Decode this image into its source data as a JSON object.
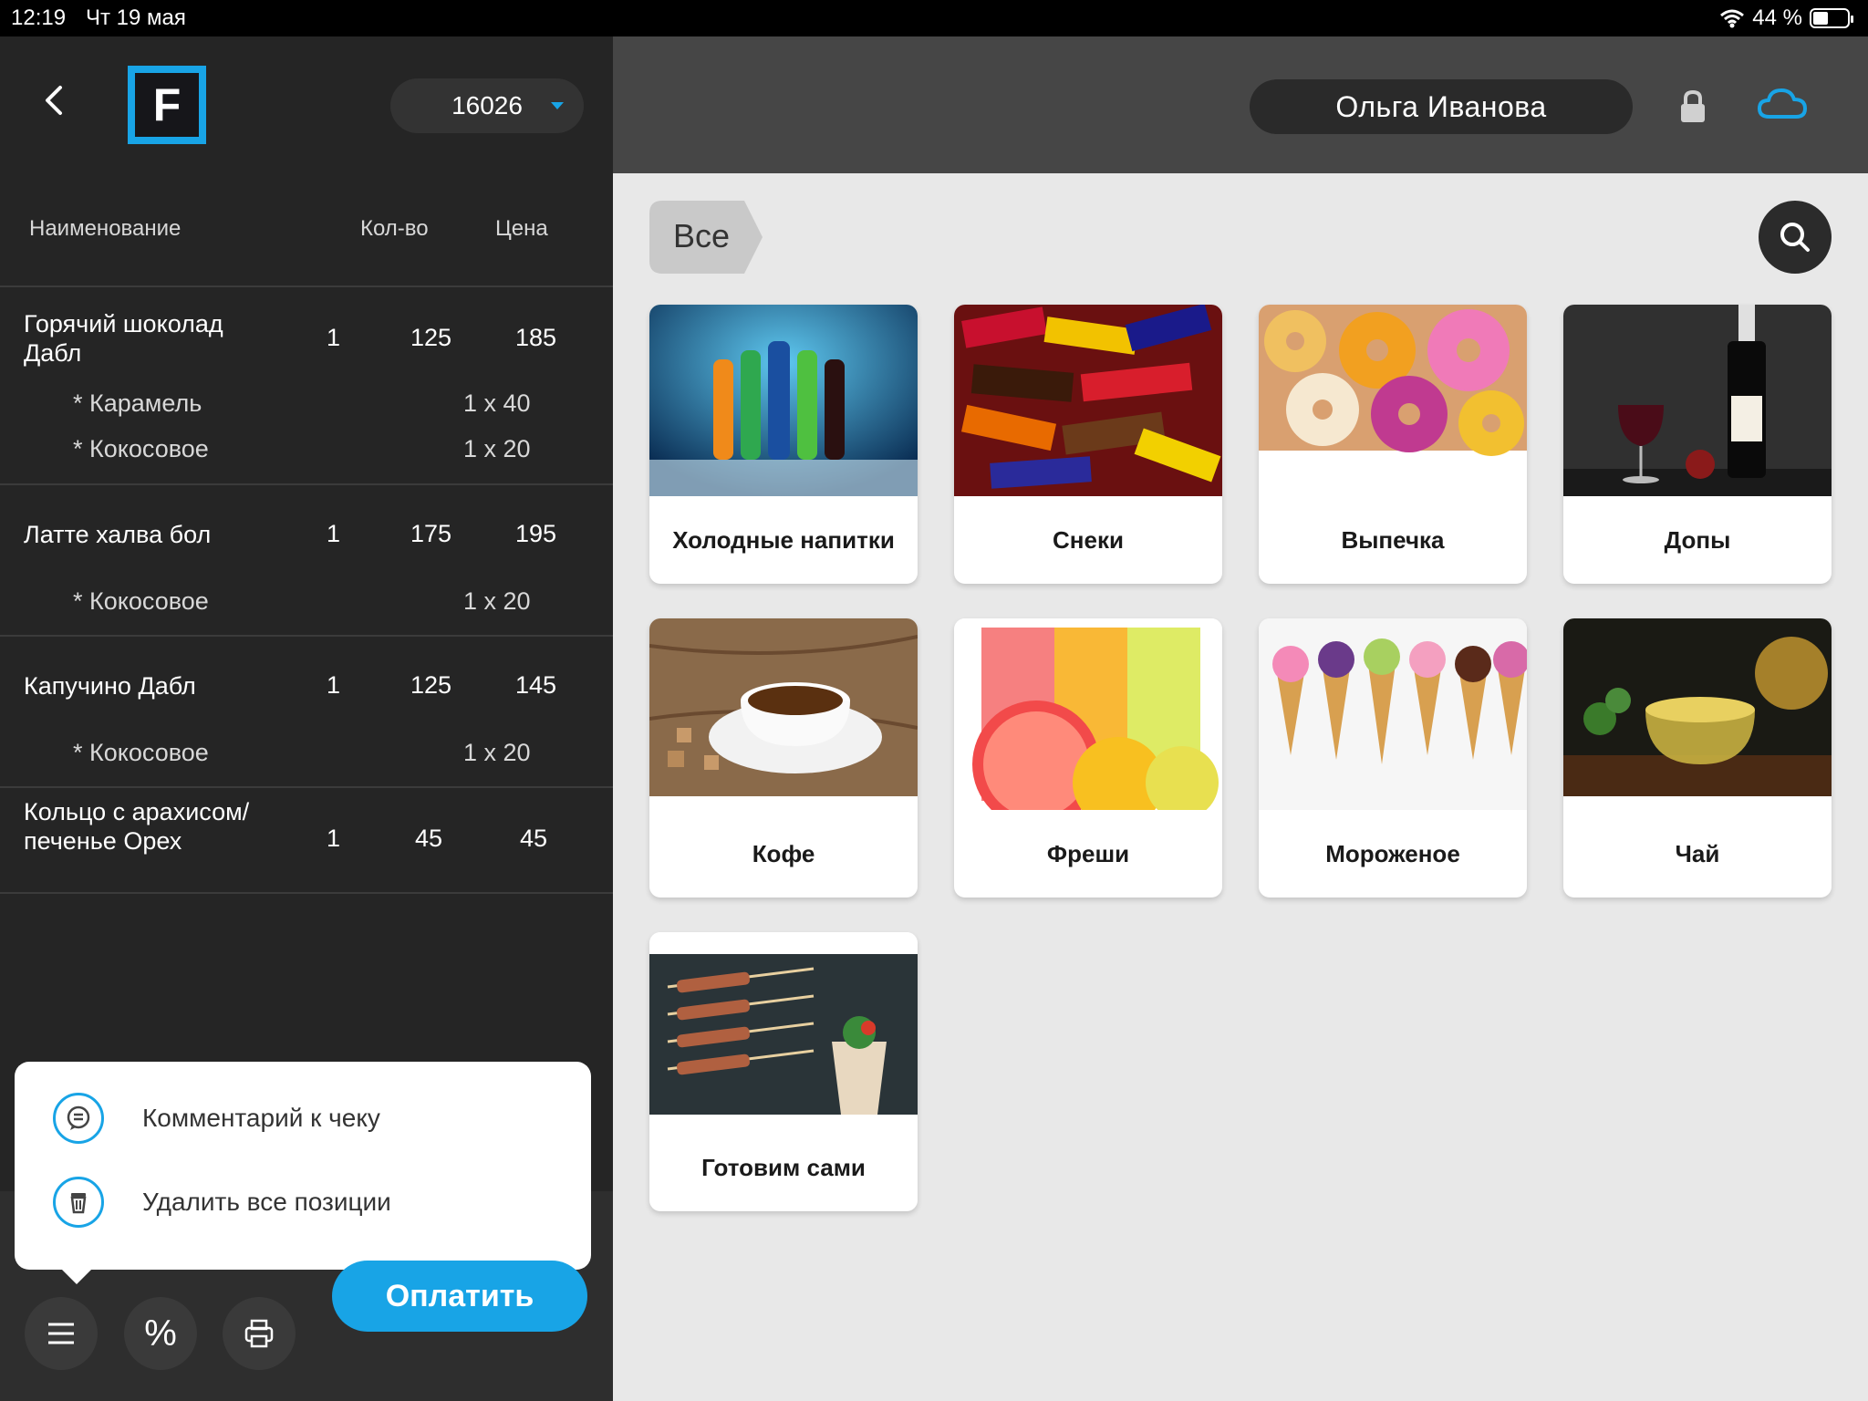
{
  "status_bar": {
    "time": "12:19",
    "date": "Чт 19 мая",
    "battery_text": "44 %",
    "battery_level": 0.44
  },
  "order": {
    "number": "16026"
  },
  "columns": {
    "name": "Наименование",
    "qty": "Кол-во",
    "price": "Цена"
  },
  "order_items": [
    {
      "name": "Горячий шоколад Дабл",
      "qty": "1",
      "price": "125",
      "total": "185",
      "modifiers": [
        {
          "name": "* Карамель",
          "value": "1 x 40"
        },
        {
          "name": "* Кокосовое",
          "value": "1 x 20"
        }
      ]
    },
    {
      "name": "Латте халва бол",
      "qty": "1",
      "price": "175",
      "total": "195",
      "modifiers": [
        {
          "name": "* Кокосовое",
          "value": "1 x 20"
        }
      ]
    },
    {
      "name": "Капучино Дабл",
      "qty": "1",
      "price": "125",
      "total": "145",
      "modifiers": [
        {
          "name": "* Кокосовое",
          "value": "1 x 20"
        }
      ]
    },
    {
      "name": "Кольцо с арахисом/печенье Орех",
      "qty": "1",
      "price": "45",
      "total": "45",
      "modifiers": []
    }
  ],
  "popup_menu": {
    "comment": "Комментарий к чеку",
    "delete_all": "Удалить все позиции"
  },
  "actions": {
    "discount_symbol": "%",
    "pay_label": "Оплатить"
  },
  "user": {
    "name": "Ольга Иванова"
  },
  "filter": {
    "all_label": "Все"
  },
  "categories": [
    {
      "label": "Холодные напитки",
      "icon": "cold-drinks-image"
    },
    {
      "label": "Снеки",
      "icon": "snacks-image"
    },
    {
      "label": "Выпечка",
      "icon": "pastry-image"
    },
    {
      "label": "Допы",
      "icon": "extras-image"
    },
    {
      "label": "Кофе",
      "icon": "coffee-image"
    },
    {
      "label": "Фреши",
      "icon": "fresh-juice-image"
    },
    {
      "label": "Мороженое",
      "icon": "ice-cream-image"
    },
    {
      "label": "Чай",
      "icon": "tea-image"
    },
    {
      "label": "Готовим сами",
      "icon": "homemade-image"
    }
  ],
  "colors": {
    "accent": "#18a4e6",
    "left_bg": "#252525",
    "topbar_bg": "#464646",
    "content_bg": "#e8e8e8"
  }
}
